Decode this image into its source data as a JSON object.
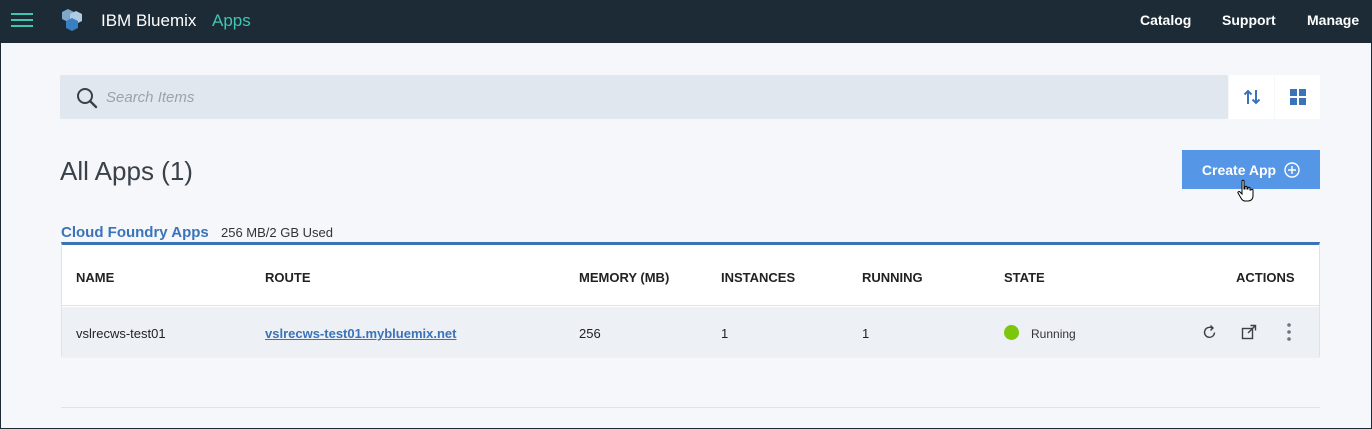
{
  "header": {
    "brand": "IBM Bluemix",
    "app_section": "Apps",
    "nav": [
      "Catalog",
      "Support",
      "Manage"
    ],
    "accent_color": "#3fc6b3",
    "bar_color": "#1c2b36"
  },
  "search": {
    "placeholder": "Search Items",
    "value": ""
  },
  "page": {
    "title": "All Apps (1)",
    "create_button": "Create App"
  },
  "section": {
    "title": "Cloud Foundry Apps",
    "usage": "256 MB/2 GB Used"
  },
  "table": {
    "columns": [
      "NAME",
      "ROUTE",
      "MEMORY (MB)",
      "INSTANCES",
      "RUNNING",
      "STATE",
      "ACTIONS"
    ],
    "rows": [
      {
        "name": "vslrecws-test01",
        "route": "vslrecws-test01.mybluemix.net",
        "memory": "256",
        "instances": "1",
        "running": "1",
        "state": "Running",
        "state_color": "#7cc70b"
      }
    ]
  },
  "icons": {
    "menu": "hamburger-menu-icon",
    "logo": "bluemix-logo",
    "search": "search-icon",
    "sort": "sort-icon",
    "grid": "grid-view-icon",
    "add": "add-circle-icon",
    "restart": "restart-icon",
    "launch": "launch-icon",
    "overflow": "more-vertical-icon"
  }
}
